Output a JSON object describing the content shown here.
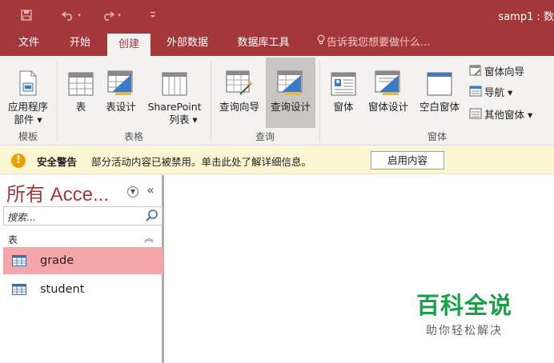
{
  "titlebar": {
    "doc_title": "samp1 : 数",
    "qat": {
      "save": "save-icon",
      "undo": "undo-icon",
      "redo": "redo-icon",
      "customize": "customize-qat-icon"
    }
  },
  "tabs": [
    {
      "label": "文件"
    },
    {
      "label": "开始"
    },
    {
      "label": "创建",
      "active": true
    },
    {
      "label": "外部数据"
    },
    {
      "label": "数据库工具"
    }
  ],
  "tell_me": {
    "icon": "lightbulb-icon",
    "text": "告诉我您想要做什么..."
  },
  "ribbon": {
    "groups": {
      "templates": "模板",
      "tables": "表格",
      "queries": "查询",
      "forms": "窗体"
    },
    "app_parts": {
      "line1": "应用程序",
      "line2": "部件 ▾"
    },
    "table": "表",
    "table_design": "表设计",
    "sharepoint": {
      "line1": "SharePoint",
      "line2": "列表 ▾"
    },
    "query_wizard": "查询向导",
    "query_design": "查询设计",
    "form": "窗体",
    "form_design": "窗体设计",
    "blank_form": "空白窗体",
    "form_wizard": "窗体向导",
    "navigation": "导航 ▾",
    "more_forms": "其他窗体 ▾"
  },
  "security": {
    "title": "安全警告",
    "message": "部分活动内容已被禁用。单击此处了解详细信息。",
    "button": "启用内容"
  },
  "nav": {
    "title": "所有 Acce...",
    "search_placeholder": "搜索...",
    "section": "表",
    "items": [
      {
        "label": "grade",
        "selected": true
      },
      {
        "label": "student",
        "selected": false
      }
    ]
  },
  "watermark": {
    "title": "百科全说",
    "subtitle": "助你轻松解决"
  },
  "colors": {
    "brand": "#a4373a",
    "ribbon_bg": "#f3f2f1",
    "selected_item": "#f4a6a8",
    "warning_bar": "#fdf6d3",
    "watermark_green": "#17a24a"
  }
}
